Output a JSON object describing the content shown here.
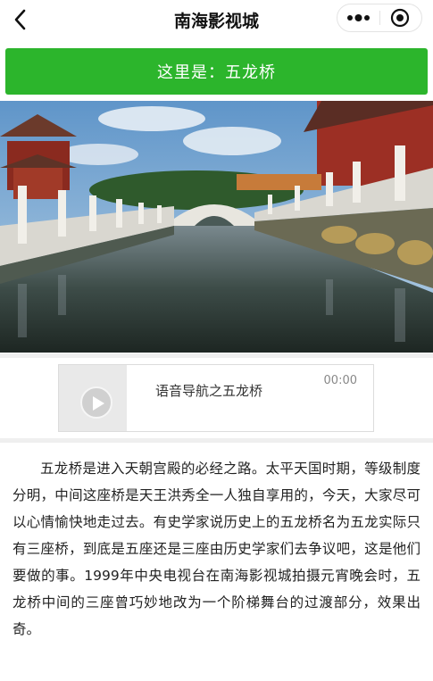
{
  "nav": {
    "title": "南海影视城",
    "back_icon": "chevron-left-icon",
    "more_icon": "more-dots-icon",
    "close_icon": "target-circle-icon"
  },
  "banner": {
    "text": "这里是：五龙桥",
    "color": "#2cb52c"
  },
  "audio": {
    "title": "语音导航之五龙桥",
    "time": "00:00",
    "play_icon": "play-icon"
  },
  "article": {
    "text": "五龙桥是进入天朝宫殿的必经之路。太平天国时期，等级制度分明，中间这座桥是天王洪秀全一人独自享用的，今天，大家尽可以心情愉快地走过去。有史学家说历史上的五龙桥名为五龙实际只有三座桥，到底是五座还是三座由历史学家们去争议吧，这是他们要做的事。1999年中央电视台在南海影视城拍摄元宵晚会时，五龙桥中间的三座曾巧妙地改为一个阶梯舞台的过渡部分，效果出奇。"
  }
}
